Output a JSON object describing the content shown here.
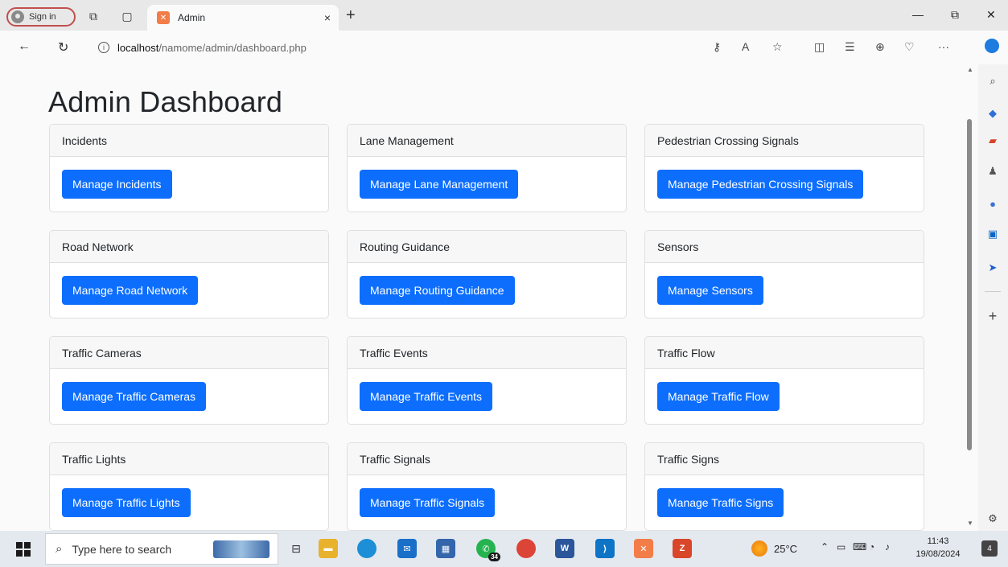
{
  "browser": {
    "signin_label": "Sign in",
    "tab_title": "Admin",
    "tab_close": "×",
    "new_tab": "+",
    "url_host": "localhost",
    "url_path": "/namome/admin/dashboard.php",
    "more_tools": "···"
  },
  "page": {
    "title": "Admin Dashboard",
    "cards": [
      {
        "header": "Incidents",
        "button": "Manage Incidents"
      },
      {
        "header": "Lane Management",
        "button": "Manage Lane Management"
      },
      {
        "header": "Pedestrian Crossing Signals",
        "button": "Manage Pedestrian Crossing Signals"
      },
      {
        "header": "Road Network",
        "button": "Manage Road Network"
      },
      {
        "header": "Routing Guidance",
        "button": "Manage Routing Guidance"
      },
      {
        "header": "Sensors",
        "button": "Manage Sensors"
      },
      {
        "header": "Traffic Cameras",
        "button": "Manage Traffic Cameras"
      },
      {
        "header": "Traffic Events",
        "button": "Manage Traffic Events"
      },
      {
        "header": "Traffic Flow",
        "button": "Manage Traffic Flow"
      },
      {
        "header": "Traffic Lights",
        "button": "Manage Traffic Lights"
      },
      {
        "header": "Traffic Signals",
        "button": "Manage Traffic Signals"
      },
      {
        "header": "Traffic Signs",
        "button": "Manage Traffic Signs"
      }
    ]
  },
  "taskbar": {
    "search_placeholder": "Type here to search",
    "whatsapp_badge": "34",
    "weather_temp": "25°C",
    "time": "11:43",
    "date": "19/08/2024",
    "notification_count": "4"
  },
  "colors": {
    "primary_button": "#0d6efd",
    "card_header_bg": "#f7f7f7",
    "card_border": "#dfdfdf"
  }
}
